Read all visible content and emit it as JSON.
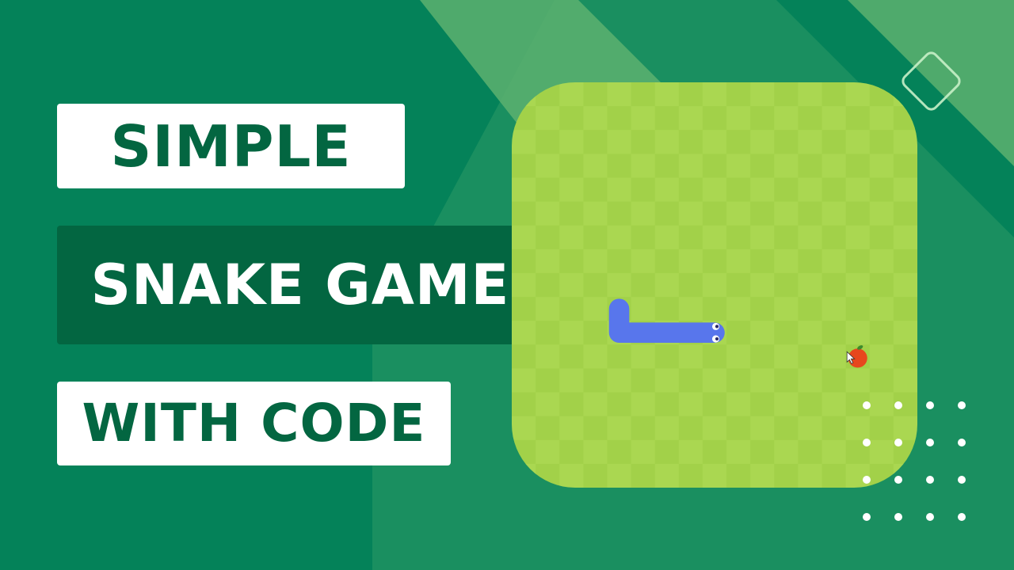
{
  "title": {
    "line1": "SIMPLE",
    "line2": "SNAKE GAME",
    "line3": "WITH CODE"
  },
  "colors": {
    "background": "#048259",
    "background_light_shape": "#5db270",
    "background_mid_shape": "#2e9a66",
    "title_dark_green": "#036641",
    "title_box_white": "#ffffff",
    "board_light": "#aad751",
    "board_dark": "#a2d149",
    "snake": "#5876ec",
    "apple": "#e7471d",
    "apple_leaf": "#3d8a2c",
    "decor_white": "#ffffff"
  },
  "game": {
    "grid_columns": 17,
    "grid_rows": 17,
    "snake_cells": [
      [
        4,
        9
      ],
      [
        4,
        10
      ],
      [
        5,
        10
      ],
      [
        6,
        10
      ],
      [
        7,
        10
      ],
      [
        8,
        10
      ]
    ],
    "snake_direction": "right",
    "apple_cell": [
      14,
      11
    ],
    "cursor_visible": true
  },
  "icons": {
    "diamond": "diamond-outline-icon",
    "dots": "dot-grid-icon",
    "apple": "apple-icon",
    "cursor": "mouse-cursor-icon"
  }
}
